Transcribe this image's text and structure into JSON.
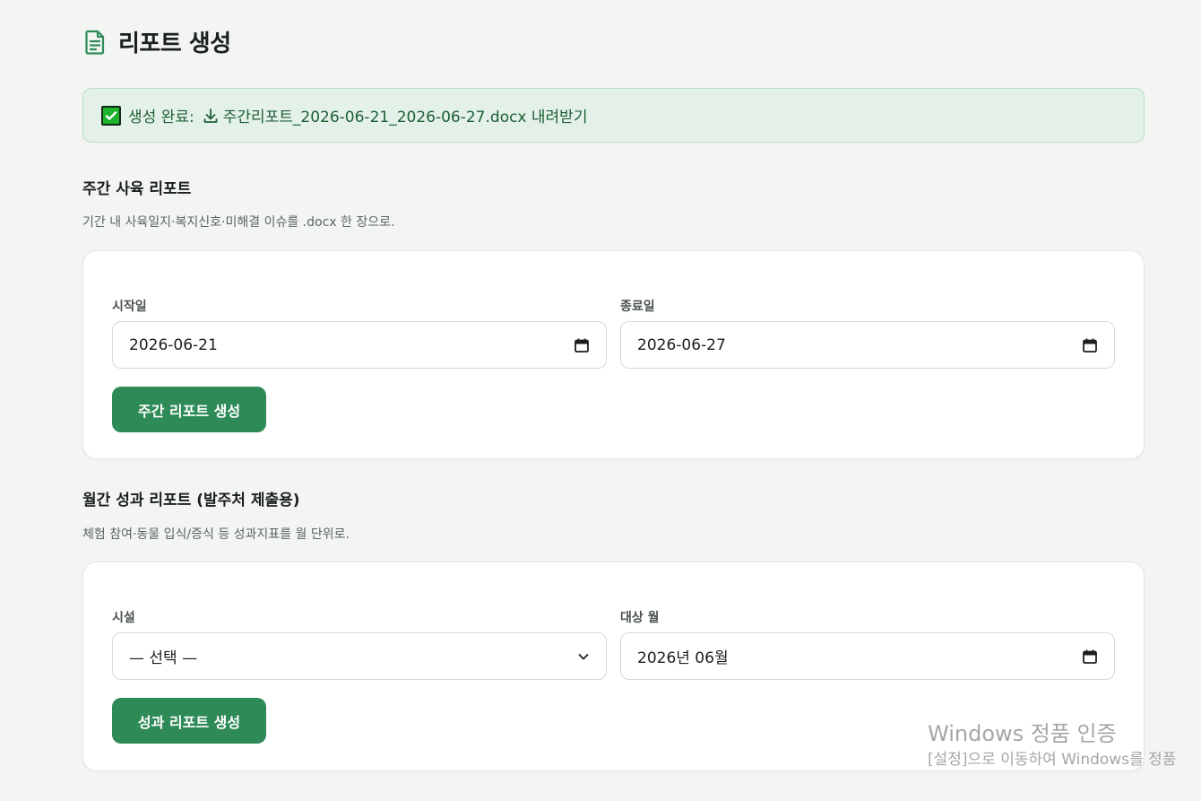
{
  "header": {
    "title": "리포트 생성",
    "icon": "document-icon"
  },
  "alert": {
    "check_icon": "check-box-icon",
    "prefix": "생성 완료:",
    "download_icon": "download-icon",
    "link_text": "주간리포트_2026-06-21_2026-06-27.docx 내려받기"
  },
  "weekly": {
    "title": "주간 사육 리포트",
    "description": "기간 내 사육일지·복지신호·미해결 이슈를 .docx 한 장으로.",
    "start_label": "시작일",
    "start_value": "2026-06-21",
    "end_label": "종료일",
    "end_value": "2026-06-27",
    "button_label": "주간 리포트 생성"
  },
  "monthly": {
    "title": "월간 성과 리포트 (발주처 제출용)",
    "description": "체험 참여·동물 입식/증식 등 성과지표를 월 단위로.",
    "facility_label": "시설",
    "facility_value": "— 선택 —",
    "month_label": "대상 월",
    "month_value": "2026년 06월",
    "button_label": "성과 리포트 생성"
  },
  "watermark": {
    "line1": "Windows 정품 인증",
    "line2": "[설정]으로 이동하여 Windows를 정품"
  },
  "colors": {
    "accent": "#2e8b57",
    "alert_bg": "#e4f1e8",
    "alert_text": "#1d5e36",
    "background": "#f3f5f3"
  }
}
